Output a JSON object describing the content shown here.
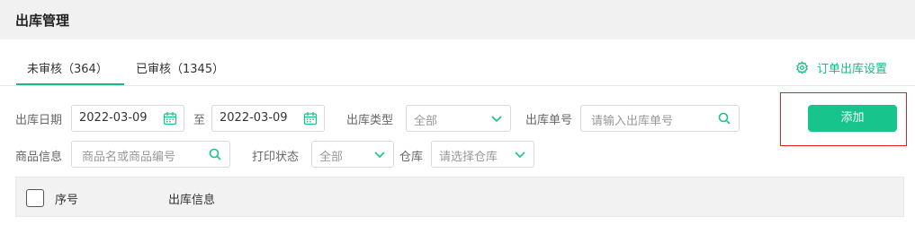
{
  "header": {
    "title": "出库管理"
  },
  "tabs": [
    {
      "label": "未审核（364）"
    },
    {
      "label": "已审核（1345）"
    }
  ],
  "settings": {
    "label": "订单出库设置",
    "icon": "gear-icon"
  },
  "filters": {
    "date_label": "出库日期",
    "date_from": "2022-03-09",
    "date_to_sep": "至",
    "date_to": "2022-03-09",
    "type_label": "出库类型",
    "type_value": "全部",
    "order_no_label": "出库单号",
    "order_no_placeholder": "请输入出库单号",
    "product_label": "商品信息",
    "product_placeholder": "商品名或商品编号",
    "print_label": "打印状态",
    "print_value": "全部",
    "warehouse_label": "仓库",
    "warehouse_placeholder": "请选择仓库"
  },
  "actions": {
    "add_label": "添加"
  },
  "table": {
    "columns": [
      "序号",
      "出库信息"
    ]
  },
  "colors": {
    "accent": "#17c48c",
    "highlight_border": "#e02020"
  }
}
